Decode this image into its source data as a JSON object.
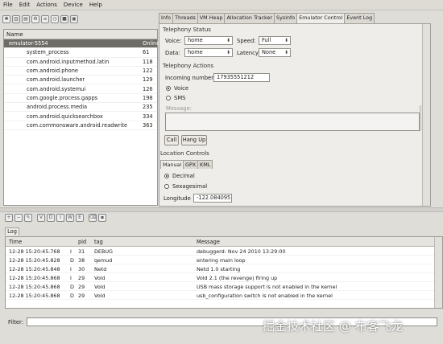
{
  "menu": [
    "File",
    "Edit",
    "Actions",
    "Device",
    "Help"
  ],
  "devices": {
    "col_name": "Name",
    "col_port": "",
    "selected": {
      "name": "emulator-5554",
      "status": "Online"
    },
    "processes": [
      {
        "name": "system_process",
        "port": "61"
      },
      {
        "name": "com.android.inputmethod.latin",
        "port": "118"
      },
      {
        "name": "com.android.phone",
        "port": "122"
      },
      {
        "name": "com.android.launcher",
        "port": "129"
      },
      {
        "name": "com.android.systemui",
        "port": "126"
      },
      {
        "name": "com.google.process.gapps",
        "port": "198"
      },
      {
        "name": "android.process.media",
        "port": "235"
      },
      {
        "name": "com.android.quicksearchbox",
        "port": "334"
      },
      {
        "name": "com.commonsware.android.readwrite",
        "port": "363"
      }
    ]
  },
  "tabs": [
    "Info",
    "Threads",
    "VM Heap",
    "Allocation Tracker",
    "Sysinfo",
    "Emulator Control",
    "Event Log"
  ],
  "active_tab": "Emulator Control",
  "telephony_status": {
    "title": "Telephony Status",
    "voice_label": "Voice:",
    "voice_value": "home",
    "speed_label": "Speed:",
    "speed_value": "Full",
    "data_label": "Data:",
    "data_value": "home",
    "latency_label": "Latency:",
    "latency_value": "None"
  },
  "telephony_actions": {
    "title": "Telephony Actions",
    "incoming_label": "Incoming number:",
    "incoming_value": "17935551212",
    "voice_radio": "Voice",
    "sms_radio": "SMS",
    "message_label": "Message:",
    "call_button": "Call",
    "hangup_button": "Hang Up"
  },
  "location": {
    "title": "Location Controls",
    "tabs": [
      "Manual",
      "GPX",
      "KML"
    ],
    "decimal": "Decimal",
    "sexagesimal": "Sexagesimal",
    "longitude_label": "Longitude",
    "longitude_value": "-122.084095"
  },
  "log": {
    "tab": "Log",
    "headers": {
      "time": "Time",
      "pid": "pid",
      "tag": "tag",
      "message": "Message"
    },
    "rows": [
      {
        "time": "12-28 15:20:45.768",
        "level": "I",
        "pid": "31",
        "tag": "DEBUG",
        "message": "debuggerd: Nov 24 2010 13:29:00"
      },
      {
        "time": "12-28 15:20:45.828",
        "level": "D",
        "pid": "38",
        "tag": "qemud",
        "message": "entering main loop"
      },
      {
        "time": "12-28 15:20:45.848",
        "level": "I",
        "pid": "30",
        "tag": "Netd",
        "message": "Netd 1.0 starting"
      },
      {
        "time": "12-28 15:20:45.868",
        "level": "I",
        "pid": "29",
        "tag": "Vold",
        "message": "Vold 2.1 (the revenge) firing up"
      },
      {
        "time": "12-28 15:20:45.868",
        "level": "D",
        "pid": "29",
        "tag": "Vold",
        "message": "USB mass storage support is not enabled in the kernel"
      },
      {
        "time": "12-28 15:20:45.868",
        "level": "D",
        "pid": "29",
        "tag": "Vold",
        "message": "usb_configuration switch is not enabled in the kernel"
      }
    ]
  },
  "filter_label": "Filter:",
  "watermark": "掘金技术社区 @ 布客飞龙"
}
